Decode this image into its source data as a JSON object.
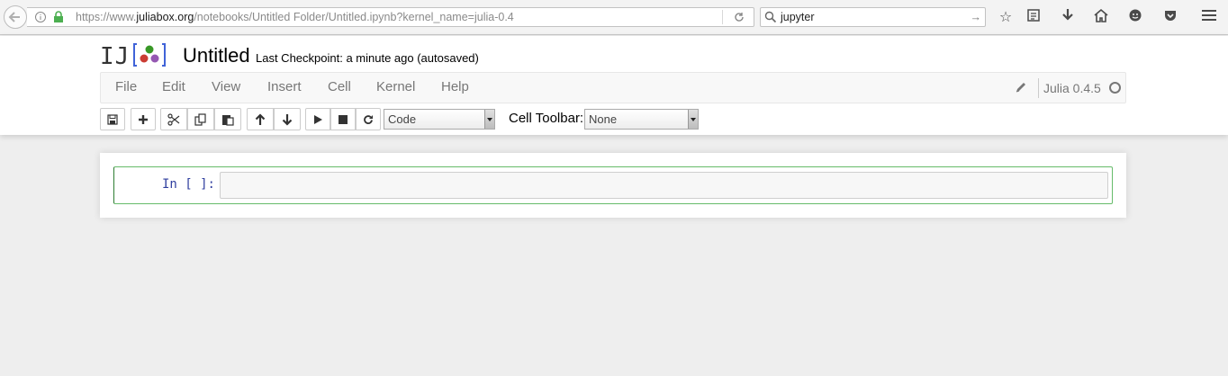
{
  "browser": {
    "url_prefix": "https://www.",
    "url_host": "juliabox.org",
    "url_path": "/notebooks/Untitled Folder/Untitled.ipynb?kernel_name=julia-0.4",
    "search_value": "jupyter"
  },
  "header": {
    "logo_text": "IJ",
    "title": "Untitled",
    "checkpoint": "Last Checkpoint: a minute ago (autosaved)"
  },
  "menu": {
    "items": [
      "File",
      "Edit",
      "View",
      "Insert",
      "Cell",
      "Kernel",
      "Help"
    ],
    "kernel_name": "Julia 0.4.5"
  },
  "toolbar": {
    "cell_type_value": "Code",
    "cell_toolbar_label": "Cell Toolbar:",
    "cell_toolbar_value": "None"
  },
  "cells": [
    {
      "prompt": "In [ ]:",
      "source": ""
    }
  ],
  "colors": {
    "jupyter_green": "#66bb6a",
    "prompt_blue": "#303F9F",
    "logo_red": "#cb3c33",
    "logo_green": "#389826",
    "logo_purple": "#9558b2",
    "logo_bracket": "#4063d8"
  }
}
